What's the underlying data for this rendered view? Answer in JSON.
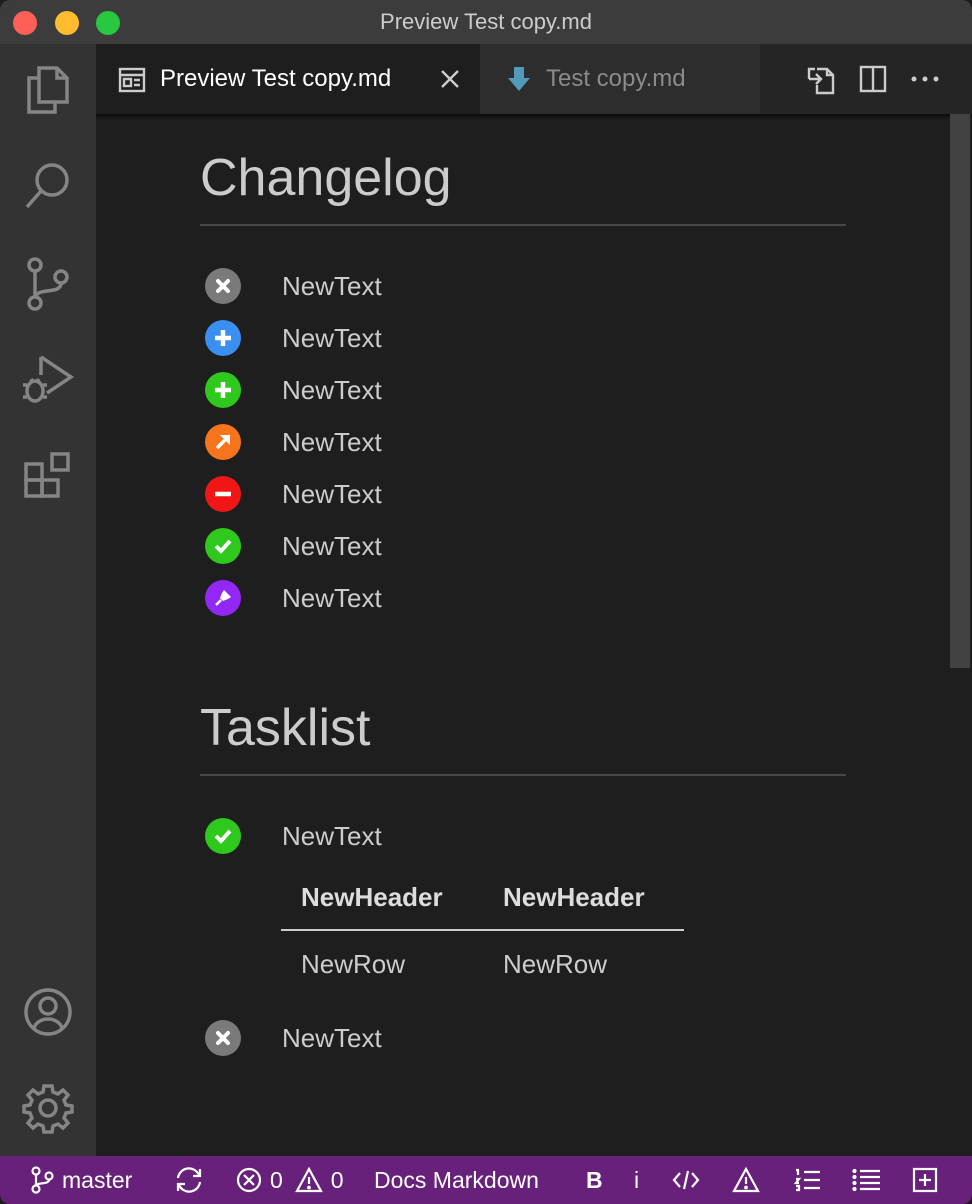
{
  "window": {
    "title": "Preview Test copy.md"
  },
  "activity_bar": {
    "items": [
      "explorer-icon",
      "search-icon",
      "source-control-icon",
      "run-debug-icon",
      "extensions-icon"
    ],
    "bottom": [
      "account-icon",
      "settings-gear-icon"
    ]
  },
  "tabs": [
    {
      "label": "Preview Test copy.md",
      "icon": "preview-icon",
      "active": true
    },
    {
      "label": "Test copy.md",
      "icon": "markdown-arrow-icon",
      "active": false
    }
  ],
  "colors": {
    "gray": "#7a7a7a",
    "blue": "#3b8ff0",
    "green": "#2ec91c",
    "orange": "#f7731c",
    "red": "#f01616",
    "purple": "#9327f5",
    "status_bar": "#68217a"
  },
  "changelog": {
    "heading": "Changelog",
    "items": [
      {
        "text": "NewText",
        "icon": "x-icon",
        "color": "#7a7a7a"
      },
      {
        "text": "NewText",
        "icon": "plus-icon",
        "color": "#3b8ff0"
      },
      {
        "text": "NewText",
        "icon": "plus-icon",
        "color": "#2ec91c"
      },
      {
        "text": "NewText",
        "icon": "arrow-up-right-icon",
        "color": "#f7731c"
      },
      {
        "text": "NewText",
        "icon": "minus-icon",
        "color": "#f01616"
      },
      {
        "text": "NewText",
        "icon": "check-icon",
        "color": "#2ec91c"
      },
      {
        "text": "NewText",
        "icon": "pin-icon",
        "color": "#9327f5"
      }
    ]
  },
  "tasklist": {
    "heading": "Tasklist",
    "items": [
      {
        "text": "NewText",
        "icon": "check-icon",
        "color": "#2ec91c"
      },
      {
        "text": "NewText",
        "icon": "x-icon",
        "color": "#7a7a7a"
      }
    ],
    "table": {
      "headers": [
        "NewHeader",
        "NewHeader"
      ],
      "rows": [
        [
          "NewRow",
          "NewRow"
        ]
      ]
    }
  },
  "status_bar": {
    "branch": "master",
    "errors": "0",
    "warnings": "0",
    "mode": "Docs Markdown",
    "bold": "B",
    "italic": "i"
  }
}
